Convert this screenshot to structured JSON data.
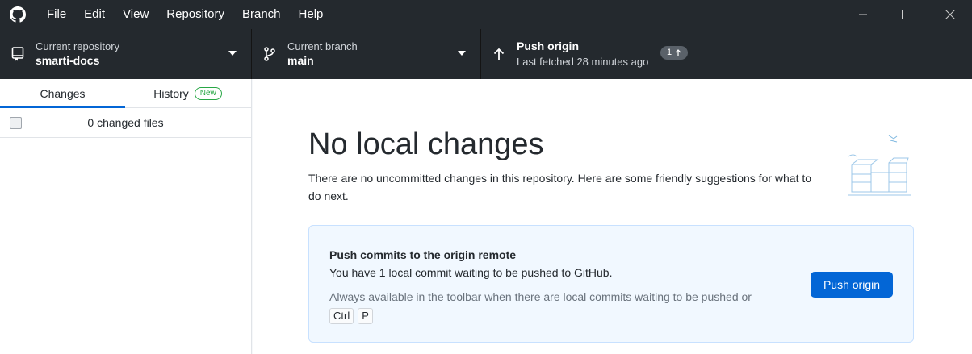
{
  "menubar": {
    "items": [
      "File",
      "Edit",
      "View",
      "Repository",
      "Branch",
      "Help"
    ],
    "logo_icon": "github-icon",
    "controls": [
      "minimize-icon",
      "maximize-icon",
      "close-icon"
    ]
  },
  "toolbar": {
    "repo": {
      "label": "Current repository",
      "value": "smarti-docs",
      "icon": "repo-icon"
    },
    "branch": {
      "label": "Current branch",
      "value": "main",
      "icon": "branch-icon"
    },
    "push": {
      "title": "Push origin",
      "subtitle": "Last fetched 28 minutes ago",
      "badge": "1",
      "badge_icon": "arrow-up-icon",
      "icon": "arrow-up-icon"
    }
  },
  "sidebar": {
    "tabs": [
      {
        "label": "Changes",
        "active": true
      },
      {
        "label": "History",
        "badge": "New"
      }
    ],
    "changed_files": "0 changed files"
  },
  "main": {
    "title": "No local changes",
    "description": "There are no uncommitted changes in this repository. Here are some friendly suggestions for what to do next.",
    "card": {
      "title": "Push commits to the origin remote",
      "line": "You have 1 local commit waiting to be pushed to GitHub.",
      "hint": "Always available in the toolbar when there are local commits waiting to be pushed or",
      "shortcut": [
        "Ctrl",
        "P"
      ],
      "button_label": "Push origin"
    }
  },
  "colors": {
    "toolbar_bg": "#24292e",
    "accent": "#0366d6",
    "new_badge": "#28a745"
  }
}
